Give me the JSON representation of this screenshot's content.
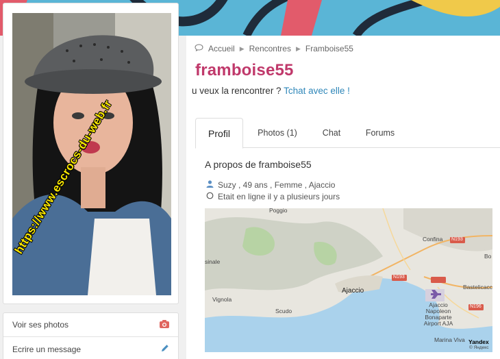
{
  "colors": {
    "accent_pink": "#c0396b",
    "link_blue": "#2f87b9",
    "banner_blue": "#5ab5d6",
    "watermark_yellow": "#f5e400"
  },
  "watermark_text": "https://www.escrocs-du-web.fr",
  "actions": [
    {
      "label": "Voir ses photos",
      "icon": "camera-icon"
    },
    {
      "label": "Ecrire un message",
      "icon": "pencil-icon"
    }
  ],
  "breadcrumb": {
    "items": [
      "Accueil",
      "Rencontres",
      "Framboise55"
    ],
    "icon": "chat-bubble-icon"
  },
  "profile": {
    "username": "framboise55",
    "question_text": "u veux la rencontrer ? ",
    "question_link": "Tchat avec elle !",
    "about_title": "A propos de framboise55",
    "details": "Suzy , 49 ans , Femme , Ajaccio",
    "status": "Etait en ligne il y a plusieurs jours"
  },
  "tabs": [
    "Profil",
    "Photos (1)",
    "Chat",
    "Forums"
  ],
  "active_tab": "Profil",
  "map": {
    "labels": [
      "Poggio",
      "Confina",
      "N193",
      "sinale",
      "Bo",
      "N193",
      "Bastelicacc",
      "Vignola",
      "Ajaccio",
      "Scudo",
      "N196",
      "Ajaccio Napoleon Bonaparte Airport AJA",
      "Marina Viva",
      "Yandex",
      "© Яндекс"
    ]
  }
}
